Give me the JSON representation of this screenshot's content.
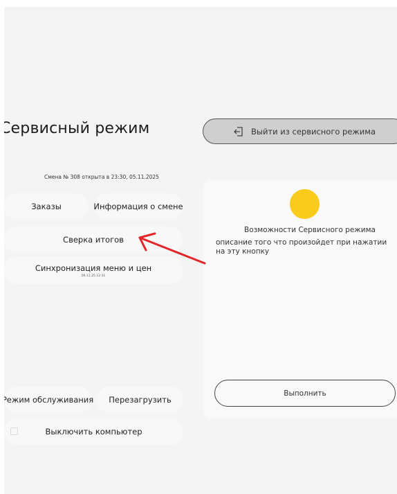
{
  "header": {
    "title": "Сервисный режим",
    "exit_button_label": "Выйти из сервисного режима",
    "exit_icon": "logout-icon"
  },
  "shift": {
    "info": "Смена № 308 открыта в 23:30, 05.11.2025"
  },
  "actions": {
    "orders": "Заказы",
    "shift_info": "Информация о смене",
    "reconcile": "Сверка итогов",
    "sync": "Синхронизация меню и цен",
    "sync_timestamp": "06.11.25 12:31",
    "maintenance": "Режим обслуживания",
    "reboot": "Перезагрузить",
    "shutdown": "Выключить компьютер"
  },
  "panel": {
    "heading": "Возможности Сервисного режима",
    "description": "описание того что произойдет при нажатии на эту кнопку",
    "execute_label": "Выполнить",
    "icon_color": "#f8cb1c"
  },
  "annotation": {
    "arrow_color": "#e3262a"
  }
}
